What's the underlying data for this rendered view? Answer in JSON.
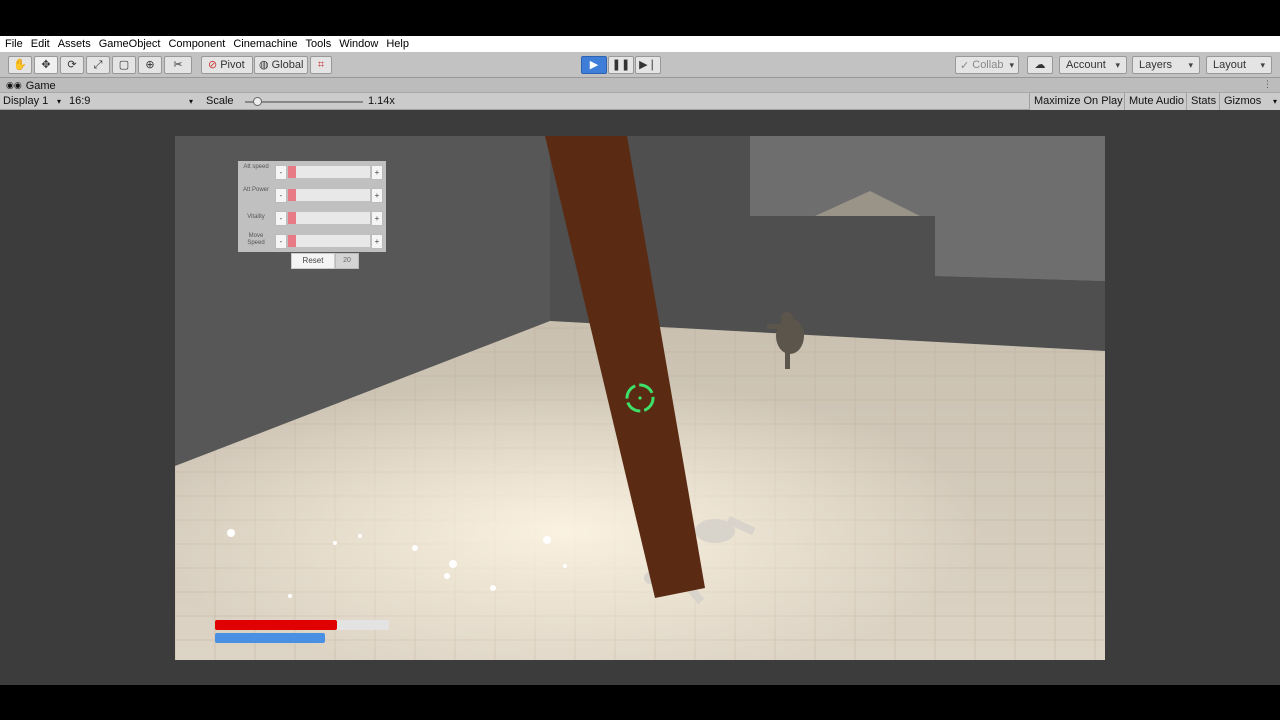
{
  "menu": [
    "File",
    "Edit",
    "Assets",
    "GameObject",
    "Component",
    "Cinemachine",
    "Tools",
    "Window",
    "Help"
  ],
  "toolbar": {
    "pivot_label": "Pivot",
    "global_label": "Global",
    "collab_label": "Collab",
    "account_label": "Account",
    "layers_label": "Layers",
    "layout_label": "Layout"
  },
  "tab": {
    "title": "Game"
  },
  "game_toolbar": {
    "display": "Display 1",
    "aspect": "16:9",
    "scale_label": "Scale",
    "scale_value": "1.14x",
    "scale_fraction": 0.1,
    "maximize_label": "Maximize On Play",
    "mute_label": "Mute Audio",
    "stats_label": "Stats",
    "gizmos_label": "Gizmos"
  },
  "game_ui": {
    "sliders": [
      {
        "label": "Att speed",
        "level": 0.1
      },
      {
        "label": "Att Power",
        "level": 0.1
      },
      {
        "label": "Vitality",
        "level": 0.1
      },
      {
        "label": "Move Speed",
        "level": 0.1
      }
    ],
    "minus": "-",
    "plus": "+",
    "reset_label": "Reset",
    "points": "20",
    "health_fraction": 0.7,
    "mana_fraction": 0.63
  },
  "colors": {
    "health": "#e00000",
    "mana": "#4a90e2",
    "crosshair": "#3ee06a",
    "pillar": "#5a2a12",
    "play_active": "#3f7ed8"
  }
}
